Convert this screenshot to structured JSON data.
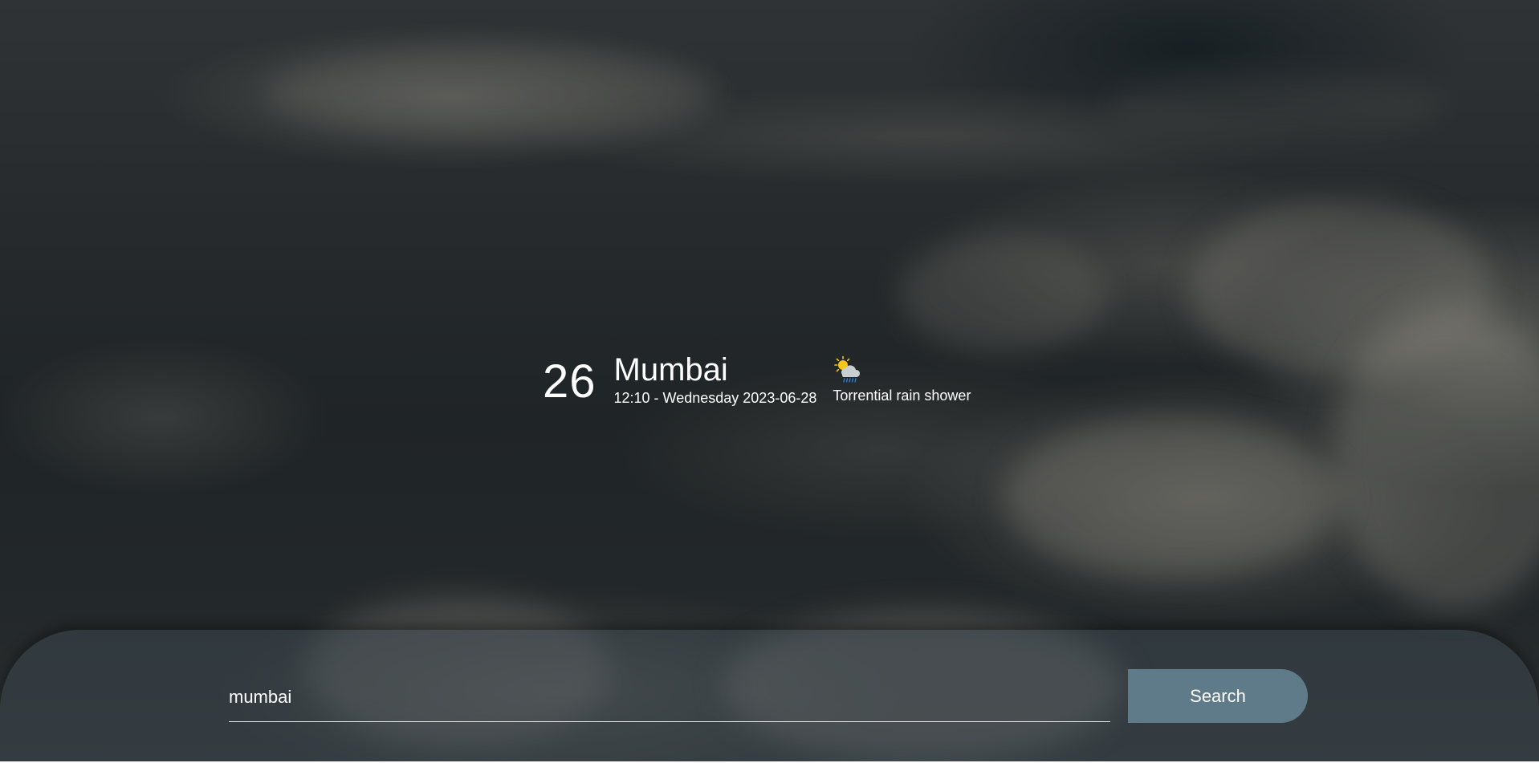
{
  "weather": {
    "temperature": "26",
    "city": "Mumbai",
    "datetime": "12:10 - Wednesday 2023-06-28",
    "condition": "Torrential rain shower",
    "condition_icon": "sun-cloud-rain-icon"
  },
  "search": {
    "value": "mumbai",
    "button_label": "Search"
  },
  "colors": {
    "button": "#5f7b89",
    "panel": "rgba(72,84,94,0.38)",
    "text": "#ffffff"
  }
}
